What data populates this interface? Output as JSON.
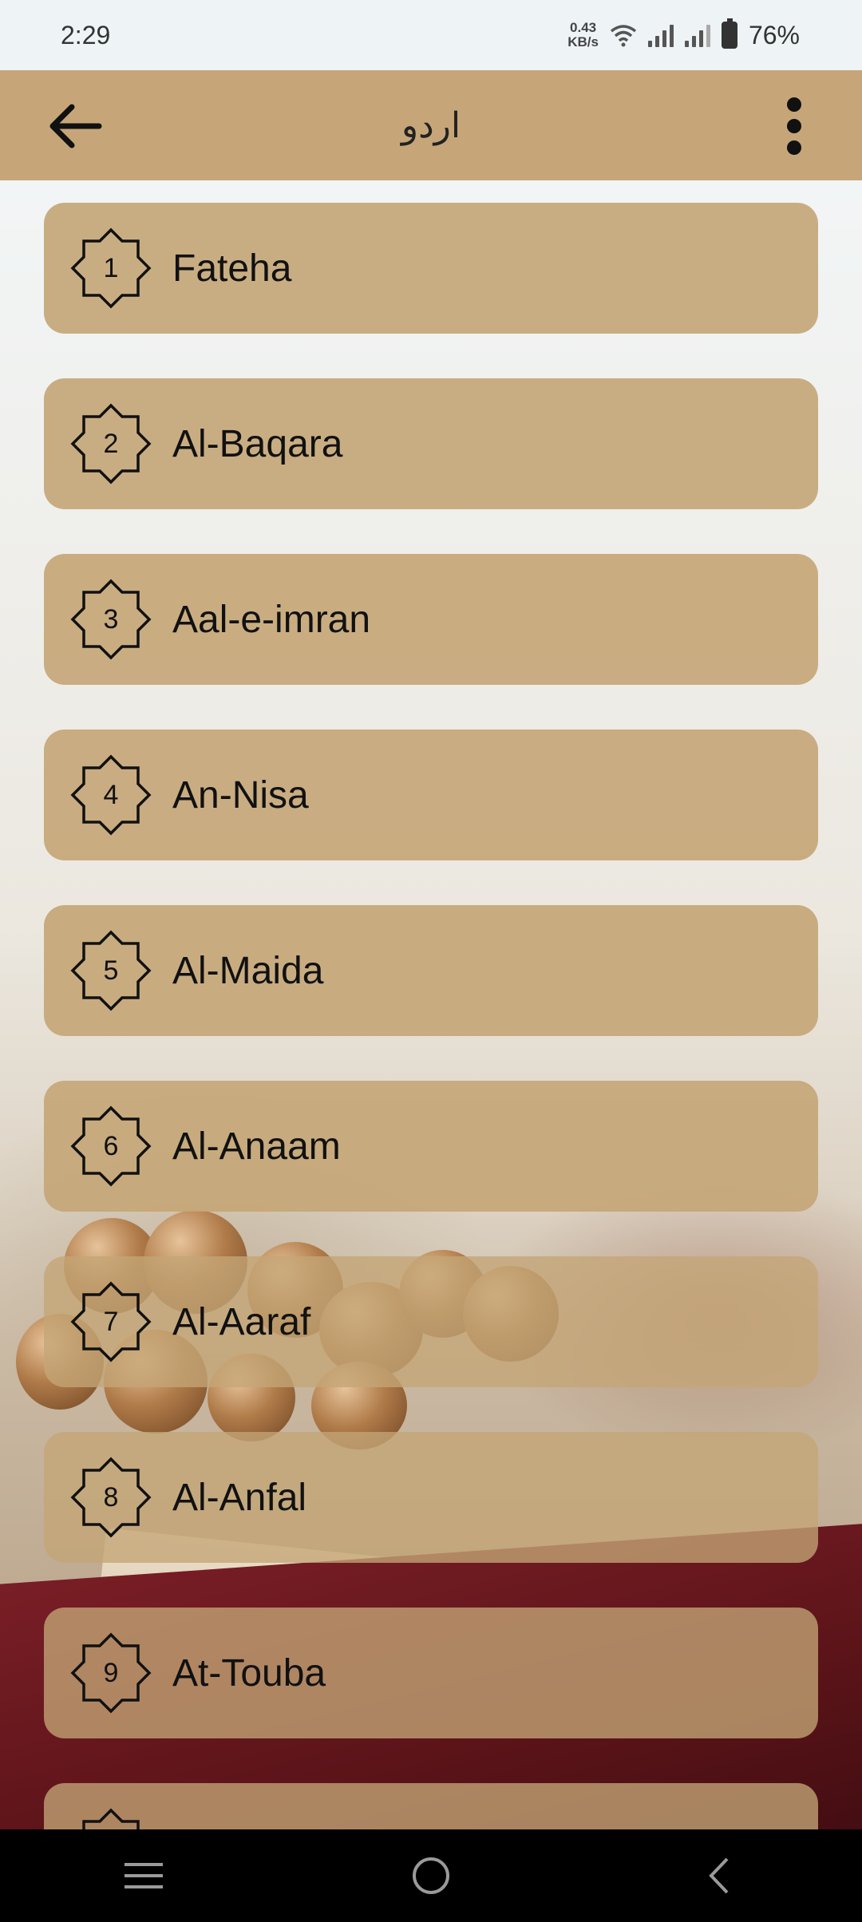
{
  "status_bar": {
    "time": "2:29",
    "net_speed": "0.43",
    "net_unit": "KB/s",
    "battery": "76%"
  },
  "app_bar": {
    "title": "اردو",
    "back_icon": "arrow-left-icon",
    "menu_icon": "more-vertical-icon"
  },
  "chapters": [
    {
      "number": "1",
      "name": "Fateha"
    },
    {
      "number": "2",
      "name": "Al-Baqara"
    },
    {
      "number": "3",
      "name": "Aal-e-imran"
    },
    {
      "number": "4",
      "name": "An-Nisa"
    },
    {
      "number": "5",
      "name": "Al-Maida"
    },
    {
      "number": "6",
      "name": "Al-Anaam"
    },
    {
      "number": "7",
      "name": "Al-Aaraf"
    },
    {
      "number": "8",
      "name": "Al-Anfal"
    },
    {
      "number": "9",
      "name": "At-Touba"
    },
    {
      "number": "",
      "name": ""
    }
  ],
  "nav_bar": {
    "recents_icon": "recents-icon",
    "home_icon": "home-circle-icon",
    "back_icon": "back-chevron-icon"
  },
  "colors": {
    "accent": "#c6a678",
    "card": "#c4a576",
    "status_bg": "#eef3f6"
  }
}
